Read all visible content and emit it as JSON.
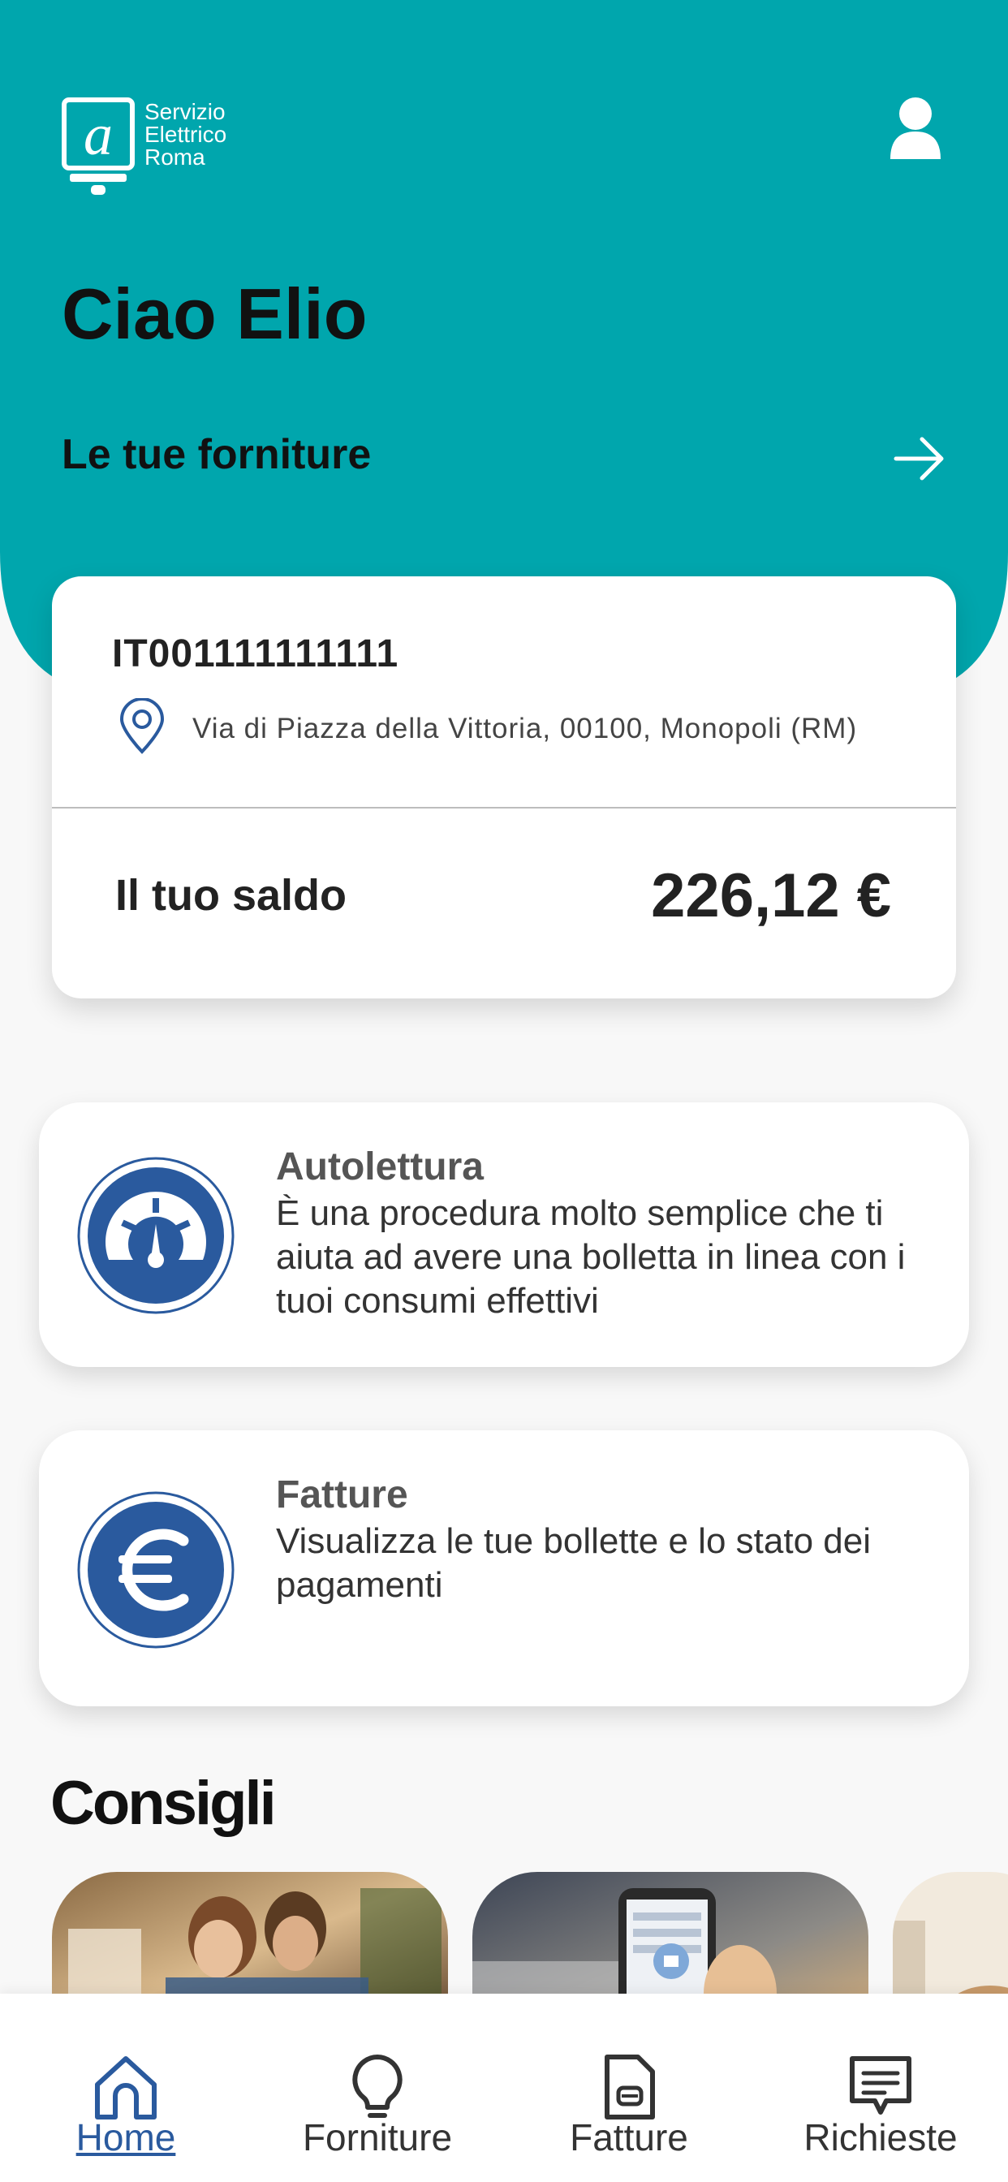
{
  "brand": {
    "line1": "Servizio",
    "line2": "Elettrico",
    "line3": "Roma"
  },
  "greeting": "Ciao Elio",
  "supplies_link": "Le tue forniture",
  "supply_card": {
    "pod": "IT001111111111",
    "address": "Via di Piazza della Vittoria, 00100, Monopoli (RM)",
    "balance_label": "Il tuo saldo",
    "balance_value": "226,12 €"
  },
  "features": [
    {
      "title": "Autolettura",
      "description": "È una procedura molto semplice che ti aiuta ad avere una bolletta in linea con i tuoi consumi effettivi",
      "icon": "gauge-icon"
    },
    {
      "title": "Fatture",
      "description": "Visualizza le tue bollette e lo stato dei pagamenti",
      "icon": "euro-icon"
    }
  ],
  "tips_title": "Consigli",
  "nav": [
    {
      "label": "Home",
      "icon": "home-icon",
      "active": true
    },
    {
      "label": "Forniture",
      "icon": "lightbulb-icon",
      "active": false
    },
    {
      "label": "Fatture",
      "icon": "document-icon",
      "active": false
    },
    {
      "label": "Richieste",
      "icon": "chat-icon",
      "active": false
    }
  ],
  "colors": {
    "teal": "#00a6ad",
    "blue": "#2a5a9e",
    "background": "#f8f8f8"
  }
}
